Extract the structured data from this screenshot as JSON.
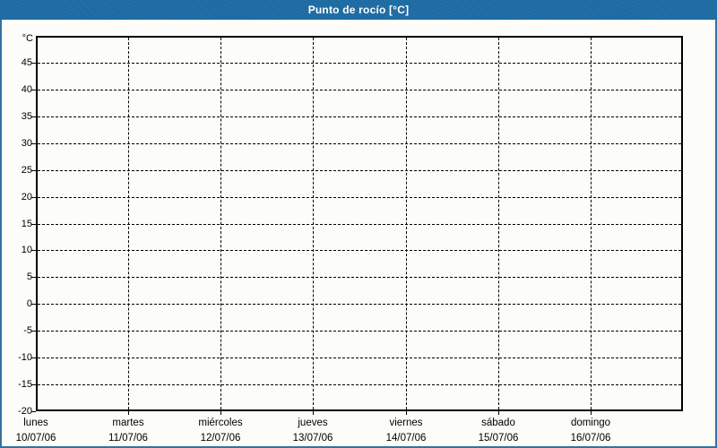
{
  "window": {
    "title": "Punto de rocío [°C]"
  },
  "colors": {
    "titlebar": "#1b69a1",
    "frame_border": "#37719f",
    "background": "#fcfdf8",
    "grid": "#000000",
    "title_text": "#ffffff"
  },
  "chart_data": {
    "type": "line",
    "title": "Punto de rocío [°C]",
    "grid": "dashed",
    "legend": "none",
    "plot_empty": true,
    "y_axis": {
      "unit": "°C",
      "min": -20,
      "max": 50,
      "tick_step": 5,
      "tick_labels": [
        45,
        40,
        35,
        30,
        25,
        20,
        15,
        10,
        5,
        0,
        -5,
        -10,
        -15,
        -20
      ]
    },
    "x_axis": {
      "days": [
        {
          "name": "lunes",
          "date": "10/07/06"
        },
        {
          "name": "martes",
          "date": "11/07/06"
        },
        {
          "name": "miércoles",
          "date": "12/07/06"
        },
        {
          "name": "jueves",
          "date": "13/07/06"
        },
        {
          "name": "viernes",
          "date": "14/07/06"
        },
        {
          "name": "sábado",
          "date": "15/07/06"
        },
        {
          "name": "domingo",
          "date": "16/07/06"
        }
      ]
    },
    "series": []
  }
}
